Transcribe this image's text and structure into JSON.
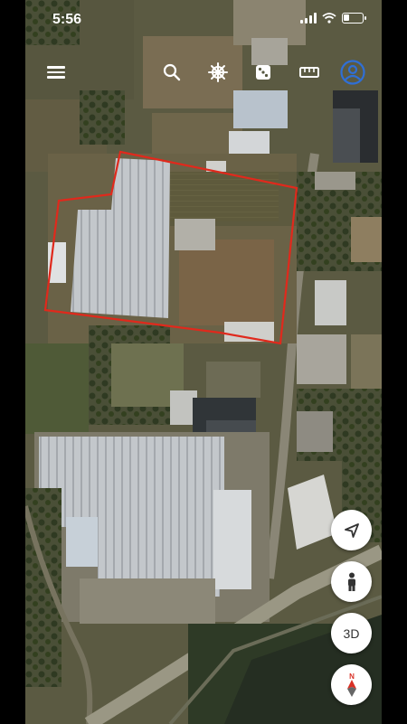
{
  "status_bar": {
    "time": "5:56",
    "battery_level": 0.3
  },
  "toolbar": {
    "menu_icon": "hamburger-menu-icon",
    "search_icon": "search-icon",
    "voyager_icon": "ship-wheel-icon",
    "random_icon": "dice-icon",
    "measure_icon": "ruler-icon",
    "profile_icon": "profile-icon",
    "accent_color": "#2f6fd6"
  },
  "map": {
    "boundary_color": "#e0291c",
    "roof_color": "#c9cdd1",
    "field_color": "#6e6447",
    "vegetation_color": "#3d4a2b"
  },
  "controls": {
    "location_icon": "navigation-arrow-icon",
    "street_view_icon": "pegman-icon",
    "view_3d_label": "3D",
    "compass_label": "N",
    "compass_color": "#d93025"
  }
}
